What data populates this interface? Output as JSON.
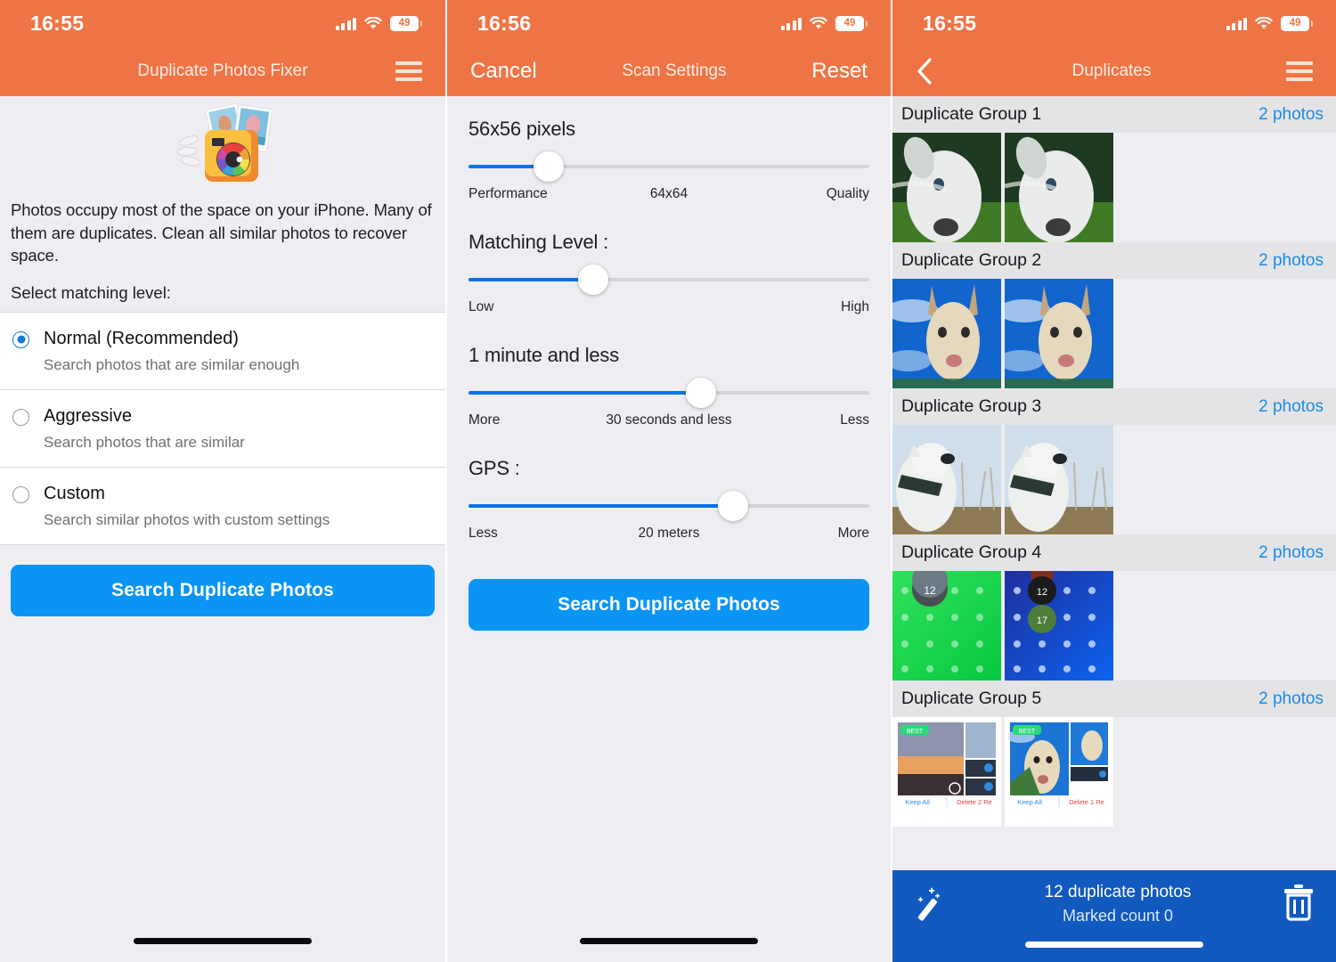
{
  "panel1": {
    "status": {
      "time": "16:55",
      "battery": "49",
      "signal_icon": "cellular-signal-icon",
      "wifi_icon": "wifi-icon",
      "battery_icon": "battery-icon"
    },
    "nav": {
      "title": "Duplicate Photos Fixer",
      "menu_icon": "hamburger-menu-icon"
    },
    "app_icon_name": "duplicate-photos-fixer-app-icon",
    "intro": "Photos occupy most of the space on your iPhone. Many of them are duplicates. Clean all similar photos to recover space.",
    "select_label": "Select matching level:",
    "options": [
      {
        "title": "Normal (Recommended)",
        "subtitle": "Search photos that are similar enough",
        "selected": true
      },
      {
        "title": "Aggressive",
        "subtitle": "Search photos that are similar",
        "selected": false
      },
      {
        "title": "Custom",
        "subtitle": "Search similar photos with custom settings",
        "selected": false
      }
    ],
    "cta_label": "Search Duplicate Photos"
  },
  "panel2": {
    "status": {
      "time": "16:56",
      "battery": "49"
    },
    "nav": {
      "cancel": "Cancel",
      "title": "Scan Settings",
      "reset": "Reset"
    },
    "sliders": [
      {
        "name": "pixel-size-slider",
        "title": "56x56 pixels",
        "fill_percent": 20,
        "left_label": "Performance",
        "mid_label": "64x64",
        "right_label": "Quality"
      },
      {
        "name": "matching-level-slider",
        "title": "Matching Level :",
        "fill_percent": 31,
        "left_label": "Low",
        "mid_label": "",
        "right_label": "High"
      },
      {
        "name": "time-slider",
        "title": "1 minute and less",
        "fill_percent": 58,
        "left_label": "More",
        "mid_label": "30 seconds and less",
        "right_label": "Less"
      },
      {
        "name": "gps-slider",
        "title": "GPS :",
        "fill_percent": 66,
        "left_label": "Less",
        "mid_label": "20 meters",
        "right_label": "More"
      }
    ],
    "cta_label": "Search Duplicate Photos"
  },
  "panel3": {
    "status": {
      "time": "16:55",
      "battery": "49"
    },
    "nav": {
      "back_icon": "back-chevron-icon",
      "title": "Duplicates",
      "menu_icon": "hamburger-menu-icon"
    },
    "groups": [
      {
        "title": "Duplicate Group 1",
        "count": "2 photos",
        "thumb_kind": "dog-grass"
      },
      {
        "title": "Duplicate Group 2",
        "count": "2 photos",
        "thumb_kind": "dog-sky"
      },
      {
        "title": "Duplicate Group 3",
        "count": "2 photos",
        "thumb_kind": "dog-collar"
      },
      {
        "title": "Duplicate Group 4",
        "count": "2 photos",
        "thumb_kind": "home-screens"
      },
      {
        "title": "Duplicate Group 5",
        "count": "2 photos",
        "thumb_kind": "app-screenshots"
      }
    ],
    "bottom": {
      "magic_icon": "magic-wand-icon",
      "line1": "12 duplicate photos",
      "line2": "Marked count 0",
      "delete_icon": "trash-icon"
    }
  },
  "colors": {
    "nav_orange": "#ef7445",
    "accent_blue": "#0a95f5",
    "slider_blue": "#0a72e8",
    "bottom_bar_blue": "#1159bf",
    "link_blue": "#1a8ae5",
    "page_bg": "#eeeef2"
  }
}
